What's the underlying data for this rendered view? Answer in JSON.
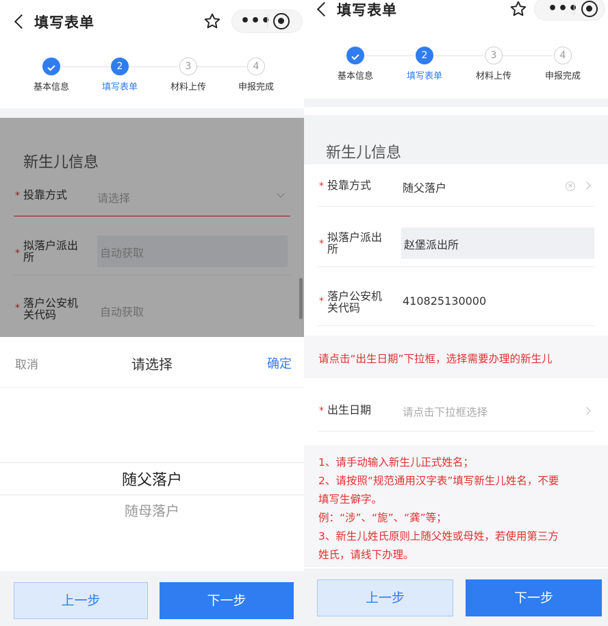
{
  "nav": {
    "title": "填写表单",
    "more": "•••"
  },
  "steps": [
    {
      "num": "",
      "label": "基本信息",
      "state": "done"
    },
    {
      "num": "2",
      "label": "填写表单",
      "state": "active"
    },
    {
      "num": "3",
      "label": "材料上传",
      "state": "todo"
    },
    {
      "num": "4",
      "label": "申报完成",
      "state": "todo"
    }
  ],
  "section": {
    "title": "新生儿信息"
  },
  "required_mark": "*",
  "left_form": {
    "method_label": "投靠方式",
    "method_placeholder": "请选择",
    "station_label_1": "拟落户派出",
    "station_label_2": "所",
    "station_value": "自动获取",
    "org_label_1": "落户公安机",
    "org_label_2": "关代码",
    "org_value": "自动获取"
  },
  "picker": {
    "cancel": "取消",
    "title": "请选择",
    "confirm": "确定",
    "options": [
      "随父落户",
      "随母落户"
    ]
  },
  "right_form": {
    "method_label": "投靠方式",
    "method_value": "随父落户",
    "station_label_1": "拟落户派出",
    "station_label_2": "所",
    "station_value": "赵堡派出所",
    "org_label_1": "落户公安机",
    "org_label_2": "关代码",
    "org_value": "410825130000",
    "notice1": "请点击“出生日期”下拉框，选择需要办理的新生儿",
    "birth_label": "出生日期",
    "birth_placeholder": "请点击下拉框选择",
    "notice2": [
      "1、请手动输入新生儿正式姓名；",
      "2、请按照“规范通用汉字表”填写新生儿姓名，不要",
      "填写生僻字。",
      "例：“涉”、“旎”、“龚”等；",
      "3、新生儿姓氏原则上随父姓或母姓，若使用第三方",
      "姓氏，请线下办理。"
    ]
  },
  "buttons": {
    "prev": "上一步",
    "next": "下一步"
  },
  "colors": {
    "primary": "#2f7df0",
    "required": "#e03131"
  }
}
